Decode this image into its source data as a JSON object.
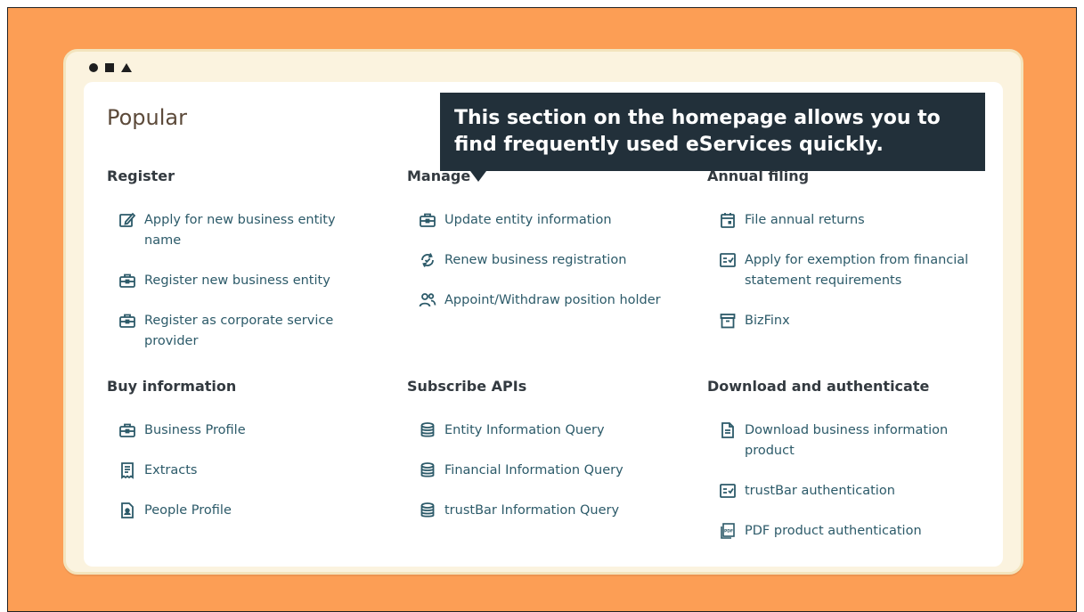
{
  "tooltip": {
    "text": "This section on the homepage allows you to find frequently used eServices quickly."
  },
  "page": {
    "title": "Popular"
  },
  "colors": {
    "background": "#fc9e55",
    "link": "#2c5a69",
    "tooltip_bg": "#22303a"
  },
  "groups": [
    {
      "title": "Register",
      "items": [
        {
          "label": "Apply for new business entity name",
          "icon": "edit-icon"
        },
        {
          "label": "Register new business entity",
          "icon": "briefcase-icon"
        },
        {
          "label": "Register as corporate service provider",
          "icon": "briefcase-icon"
        }
      ]
    },
    {
      "title": "Manage",
      "items": [
        {
          "label": "Update entity information",
          "icon": "briefcase-icon"
        },
        {
          "label": "Renew business registration",
          "icon": "renew-icon"
        },
        {
          "label": "Appoint/Withdraw position holder",
          "icon": "people-icon"
        }
      ]
    },
    {
      "title": "Annual filing",
      "items": [
        {
          "label": "File annual returns",
          "icon": "calendar-icon"
        },
        {
          "label": "Apply for exemption from financial statement requirements",
          "icon": "checklist-icon"
        },
        {
          "label": "BizFinx",
          "icon": "archive-icon"
        }
      ]
    },
    {
      "title": "Buy information",
      "items": [
        {
          "label": "Business Profile",
          "icon": "briefcase-icon"
        },
        {
          "label": "Extracts",
          "icon": "receipt-icon"
        },
        {
          "label": "People Profile",
          "icon": "person-document-icon"
        }
      ]
    },
    {
      "title": "Subscribe APIs",
      "items": [
        {
          "label": "Entity Information Query",
          "icon": "database-icon"
        },
        {
          "label": "Financial Information Query",
          "icon": "database-icon"
        },
        {
          "label": "trustBar Information Query",
          "icon": "database-icon"
        }
      ]
    },
    {
      "title": "Download and authenticate",
      "items": [
        {
          "label": "Download business information product",
          "icon": "document-icon"
        },
        {
          "label": "trustBar authentication",
          "icon": "checklist-icon"
        },
        {
          "label": "PDF product authentication",
          "icon": "pdf-icon"
        }
      ]
    }
  ]
}
